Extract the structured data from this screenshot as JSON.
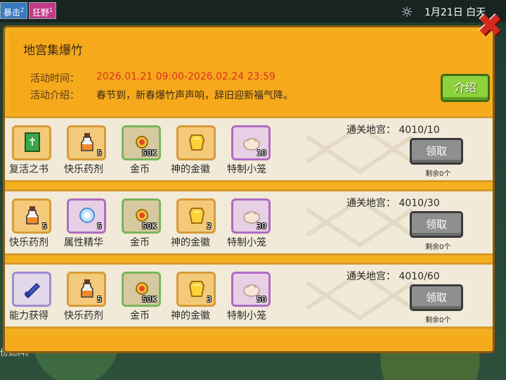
{
  "topbar": {
    "buffs": [
      {
        "label": "暴击",
        "level": "2",
        "color": "#3a78c0"
      },
      {
        "label": "狂野",
        "level": "1",
        "color": "#c03a88"
      }
    ],
    "weather_icon": "sun-icon",
    "date": "1月21日 白天"
  },
  "panel": {
    "title": "地宫集爆竹",
    "time_label": "活动时间：",
    "time_value": "2026.01.21 09:00-2026.02.24 23:59",
    "desc_label": "活动介绍：",
    "desc_value": "春节到，新春爆竹声声响，辞旧迎新福气降。",
    "intro_button": "介绍",
    "close_icon": "close-x-icon"
  },
  "rows": [
    {
      "requirement": "通关地宫：  4010/10",
      "claim_label": "领取",
      "remaining": "剩余0个",
      "items": [
        {
          "name": "复活之书",
          "qty": "",
          "icon": "green-book-icon",
          "frame": "orange"
        },
        {
          "name": "快乐药剂",
          "qty": "5",
          "icon": "potion-bottle-icon",
          "frame": "orange"
        },
        {
          "name": "金币",
          "qty": "50K",
          "icon": "gold-coin-icon",
          "frame": "green"
        },
        {
          "name": "神的金徽",
          "qty": "",
          "icon": "golden-badge-icon",
          "frame": "orange"
        },
        {
          "name": "特制小笼",
          "qty": "10",
          "icon": "steamed-bun-icon",
          "frame": "purple"
        }
      ]
    },
    {
      "requirement": "通关地宫：  4010/30",
      "claim_label": "领取",
      "remaining": "剩余0个",
      "items": [
        {
          "name": "快乐药剂",
          "qty": "5",
          "icon": "potion-bottle-icon",
          "frame": "orange"
        },
        {
          "name": "属性精华",
          "qty": "5",
          "icon": "blue-essence-icon",
          "frame": "purple"
        },
        {
          "name": "金币",
          "qty": "50K",
          "icon": "gold-coin-icon",
          "frame": "green"
        },
        {
          "name": "神的金徽",
          "qty": "2",
          "icon": "golden-badge-icon",
          "frame": "orange"
        },
        {
          "name": "特制小笼",
          "qty": "30",
          "icon": "steamed-bun-icon",
          "frame": "purple"
        }
      ]
    },
    {
      "requirement": "通关地宫：  4010/60",
      "claim_label": "领取",
      "remaining": "剩余0个",
      "items": [
        {
          "name": "能力获得",
          "qty": "",
          "icon": "blue-scroll-icon",
          "frame": "lblue"
        },
        {
          "name": "快乐药剂",
          "qty": "5",
          "icon": "potion-bottle-icon",
          "frame": "orange"
        },
        {
          "name": "金币",
          "qty": "50K",
          "icon": "gold-coin-icon",
          "frame": "green"
        },
        {
          "name": "神的金徽",
          "qty": "3",
          "icon": "golden-badge-icon",
          "frame": "orange"
        },
        {
          "name": "特制小笼",
          "qty": "50",
          "icon": "steamed-bun-icon",
          "frame": "purple"
        }
      ]
    }
  ],
  "background_text": "份燃料。"
}
